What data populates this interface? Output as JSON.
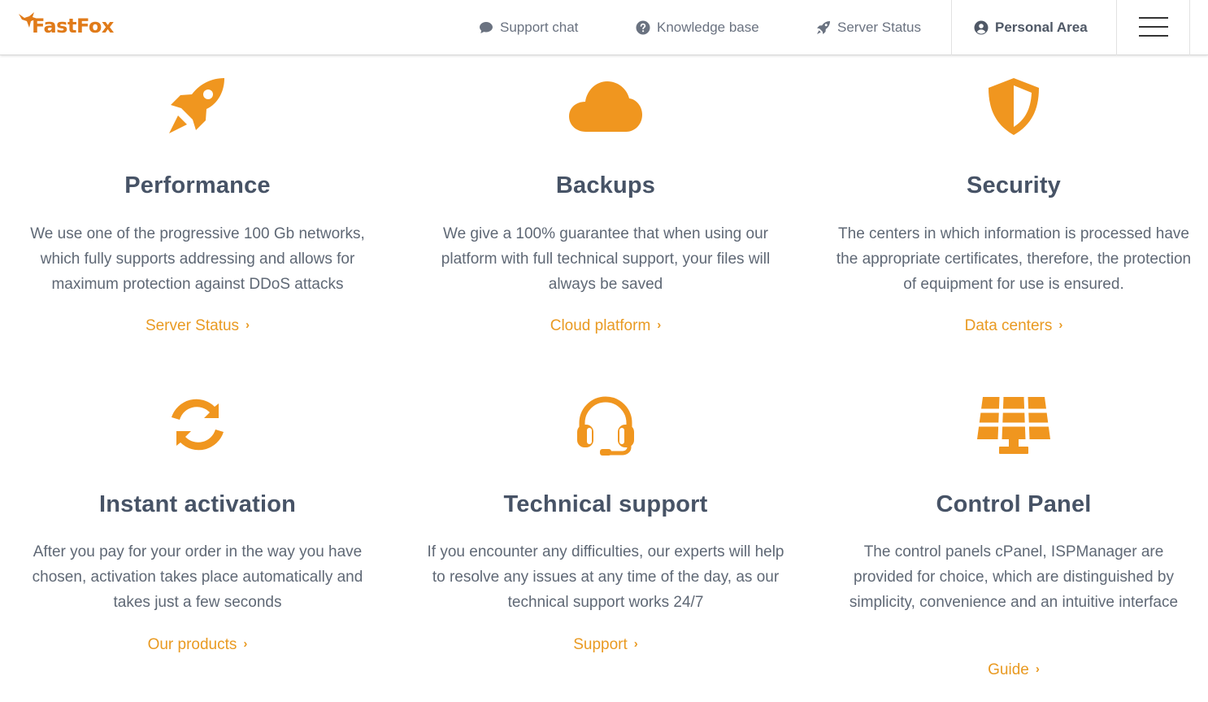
{
  "brand": {
    "name": "FastFox",
    "accent": "#e99a22",
    "logo_color": "#e07b1a"
  },
  "nav": {
    "support_chat": "Support chat",
    "knowledge_base": "Knowledge base",
    "server_status": "Server Status",
    "personal_area": "Personal Area"
  },
  "features": [
    {
      "title": "Performance",
      "icon": "rocket-icon",
      "text": "We use one of the progressive 100 Gb networks, which fully supports addressing and allows for maximum protection against DDoS attacks",
      "link": "Server Status"
    },
    {
      "title": "Backups",
      "icon": "cloud-icon",
      "text": "We give a 100% guarantee that when using our platform with full technical support, your files will always be saved",
      "link": "Cloud platform"
    },
    {
      "title": "Security",
      "icon": "shield-icon",
      "text": "The centers in which information is processed have the appropriate certificates, therefore, the protection of equipment for use is ensured.",
      "link": "Data centers"
    },
    {
      "title": "Instant activation",
      "icon": "sync-icon",
      "text": "After you pay for your order in the way you have chosen, activation takes place automatically and takes just a few seconds",
      "link": "Our products"
    },
    {
      "title": "Technical support",
      "icon": "headset-icon",
      "text": "If you encounter any difficulties, our experts will help to resolve any issues at any time of the day, as our technical support works 24/7",
      "link": "Support"
    },
    {
      "title": "Control Panel",
      "icon": "solar-panel-icon",
      "text": "The control panels cPanel, ISPManager are provided for choice, which are distinguished by simplicity, convenience and an intuitive interface",
      "link": "Guide"
    }
  ]
}
